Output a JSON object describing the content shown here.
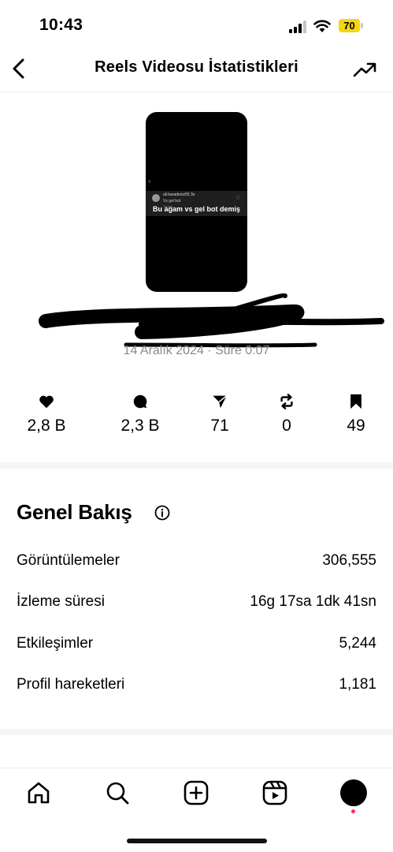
{
  "status_bar": {
    "time": "10:43",
    "battery": "70"
  },
  "header": {
    "title": "Reels Videosu İstatistikleri"
  },
  "reel": {
    "username": "ali.karadeniz55",
    "time_ago": "3s",
    "comment_text": "Vs gel bot",
    "reply_text": "Yanıtla",
    "caption": "Bu agam vs gel bot demiş"
  },
  "post_meta": "14 Aralık 2024 · Süre 0:07",
  "stats": {
    "likes": "2,8 B",
    "comments": "2,3 B",
    "shares": "71",
    "reposts": "0",
    "saves": "49"
  },
  "overview": {
    "title": "Genel Bakış",
    "rows": [
      {
        "label": "Görüntülemeler",
        "value": "306,555"
      },
      {
        "label": "İzleme süresi",
        "value": "16g 17sa 1dk 41sn"
      },
      {
        "label": "Etkileşimler",
        "value": "5,244"
      },
      {
        "label": "Profil hareketleri",
        "value": "1,181"
      }
    ]
  },
  "colors": {
    "battery": "#f5d70f",
    "notification_dot": "#ff2d55",
    "muted_text": "#8a8a8a"
  }
}
